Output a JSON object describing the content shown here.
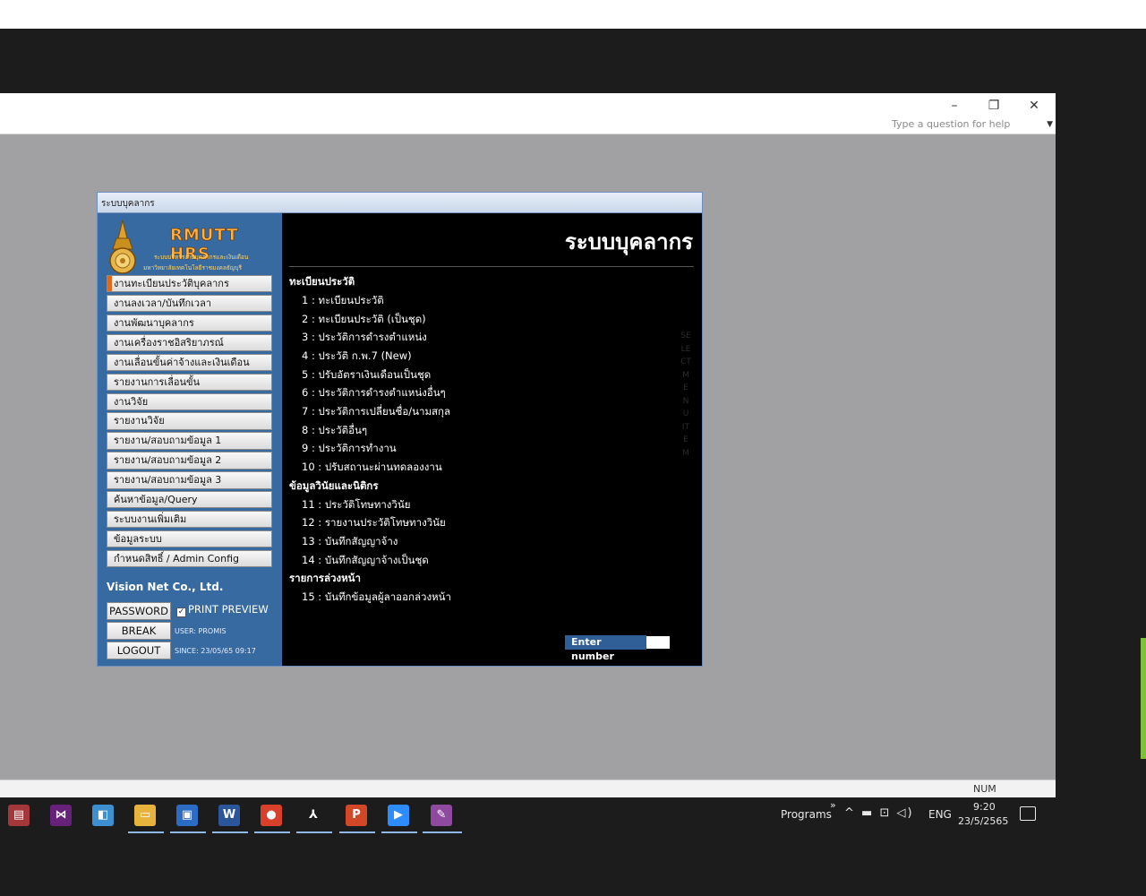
{
  "app": {
    "window_buttons": {
      "minimize": "–",
      "restore": "❐",
      "close": "✕"
    },
    "help_placeholder": "Type a question for help",
    "status_num": "NUM"
  },
  "dialog": {
    "title": "ระบบบุคลากร",
    "logo_title": "RMUTT HRS",
    "logo_sub1": "ระบบบริหารงานบุคลากรและเงินเดือน",
    "logo_sub2": "มหาวิทยาลัยเทคโนโลยีราชมงคลธัญบุรี",
    "menu": [
      "งานทะเบียนประวัติบุคลากร",
      "งานลงเวลา/บันทึกเวลา",
      "งานพัฒนาบุคลากร",
      "งานเครื่องราชอิสริยาภรณ์",
      "งานเลื่อนขั้นค่าจ้างและเงินเดือน",
      "รายงานการเลื่อนขั้น",
      "งานวิจัย",
      "รายงานวิจัย",
      "รายงาน/สอบถามข้อมูล 1",
      "รายงาน/สอบถามข้อมูล 2",
      "รายงาน/สอบถามข้อมูล 3",
      "ค้นหาข้อมูล/Query",
      "ระบบงานเพิ่มเติม",
      "ข้อมูลระบบ",
      "กำหนดสิทธิ์ / Admin Config"
    ],
    "company": "Vision Net Co., Ltd.",
    "password_label": "PASSWORD",
    "print_preview_label": "PRINT PREVIEW",
    "print_preview_checked": "✓",
    "break_label": "BREAK",
    "logout_label": "LOGOUT",
    "user_info": "USER: PROMIS",
    "since_info": "SINCE: 23/05/65 09:17",
    "content_title": "ระบบบุคลากร",
    "sections": [
      {
        "heading": "ทะเบียนประวัติ",
        "items": [
          "1 : ทะเบียนประวัติ",
          "2 : ทะเบียนประวัติ (เป็นชุด)",
          "3 : ประวัติการดำรงตำแหน่ง",
          "4 : ประวัติ ก.พ.7 (New)",
          "5 : ปรับอัตราเงินเดือนเป็นชุด",
          "6 : ประวัติการดำรงตำแหน่งอื่นๆ",
          "7 : ประวัติการเปลี่ยนชื่อ/นามสกุล",
          "8 : ประวัติอื่นๆ",
          "9 : ประวัติการทำงาน",
          "10 : ปรับสถานะผ่านทดลองงาน"
        ]
      },
      {
        "heading": "ข้อมูลวินัยและนิติกร",
        "items": [
          "11 : ประวัติโทษทางวินัย",
          "12 : รายงานประวัติโทษทางวินัย",
          "13 : บันทึกสัญญาจ้าง",
          "14 : บันทึกสัญญาจ้างเป็นชุด"
        ]
      },
      {
        "heading": "รายการล่วงหน้า",
        "items": [
          "15 : บันทึกข้อมูลผู้ลาออกล่วงหน้า"
        ]
      }
    ],
    "vertical_text": "SELECT MENU ITEM",
    "enter_label": "Enter number",
    "enter_value": ""
  },
  "taskbar": {
    "apps": [
      {
        "icon": "access-icon",
        "glyph": "▤",
        "color": "#a4373a"
      },
      {
        "icon": "visual-studio-icon",
        "glyph": "⋈",
        "color": "#68217a"
      },
      {
        "icon": "notes-icon",
        "glyph": "◧",
        "color": "#3d8fd0"
      },
      {
        "icon": "file-explorer-icon",
        "glyph": "▭",
        "color": "#e8b33c"
      },
      {
        "icon": "remote-desktop-icon",
        "glyph": "▣",
        "color": "#2b6cc4"
      },
      {
        "icon": "word-icon",
        "glyph": "W",
        "color": "#2b579a"
      },
      {
        "icon": "chrome-icon",
        "glyph": "●",
        "color": "#d9402c"
      },
      {
        "icon": "acrobat-icon",
        "glyph": "⅄",
        "color": "#1c1c1c"
      },
      {
        "icon": "powerpoint-icon",
        "glyph": "P",
        "color": "#d24726"
      },
      {
        "icon": "zoom-icon",
        "glyph": "▶",
        "color": "#2d8cff"
      },
      {
        "icon": "paint-icon",
        "glyph": "✎",
        "color": "#8e4a9f"
      }
    ],
    "programs_label": "Programs",
    "chevrons": "»",
    "tray_glyphs": "^ ▬ ⊡ ◁)",
    "lang": "ENG",
    "time": "9:20",
    "date": "23/5/2565"
  }
}
